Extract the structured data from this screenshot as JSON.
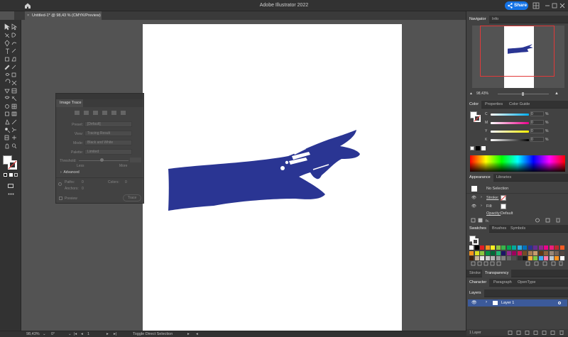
{
  "app": {
    "title": "Adobe Illustrator 2022",
    "share_label": "Share"
  },
  "document": {
    "tab_label": "Untitled-1* @ 98,43 % (CMYK/Preview)",
    "close_glyph": "×"
  },
  "image_trace": {
    "title": "Image Trace",
    "preset_label": "Preset:",
    "preset_value": "[Default]",
    "view_label": "View:",
    "view_value": "Tracing Result",
    "mode_label": "Mode:",
    "mode_value": "Black and White",
    "palette_label": "Palette:",
    "palette_value": "Limited",
    "threshold_label": "Threshold:",
    "less_label": "Less",
    "more_label": "More",
    "advanced_label": "Advanced",
    "paths_label": "Paths:",
    "paths_value": "0",
    "colors_label": "Colors:",
    "colors_value": "0",
    "anchors_label": "Anchors:",
    "anchors_value": "0",
    "preview_label": "Preview",
    "trace_button": "Trace"
  },
  "status": {
    "zoom": "98,43%",
    "rotation": "0°",
    "artboard_num": "1",
    "tool_hint": "Toggle Direct Selection"
  },
  "navigator": {
    "tab_navigator": "Navigator",
    "tab_info": "Info",
    "zoom": "98,43%"
  },
  "color_panel": {
    "tabs": [
      "Color",
      "Properties",
      "Color Guide"
    ],
    "rows": [
      {
        "letter": "C",
        "value": "0",
        "unit": "%"
      },
      {
        "letter": "M",
        "value": "0",
        "unit": "%"
      },
      {
        "letter": "Y",
        "value": "0",
        "unit": "%"
      },
      {
        "letter": "K",
        "value": "0",
        "unit": "%"
      }
    ]
  },
  "appearance": {
    "tabs": [
      "Appearance",
      "Libraries"
    ],
    "selection": "No Selection",
    "stroke_label": "Stroke:",
    "fill_label": "Fill:",
    "opacity_label": "Opacity:",
    "opacity_value": "Default"
  },
  "swatches": {
    "tabs": [
      "Swatches",
      "Brushes",
      "Symbols"
    ]
  },
  "stroke_tabs": [
    "Stroke",
    "Transparency"
  ],
  "char_tabs": [
    "Character",
    "Paragraph",
    "OpenType"
  ],
  "layers": {
    "tab": "Layers",
    "layer_name": "Layer 1",
    "count": "1 Layer"
  },
  "colors": {
    "hand": "#2a3593",
    "share": "#1473e6",
    "selection": "#3c5a9a",
    "nav_frame": "#e03a3a"
  }
}
